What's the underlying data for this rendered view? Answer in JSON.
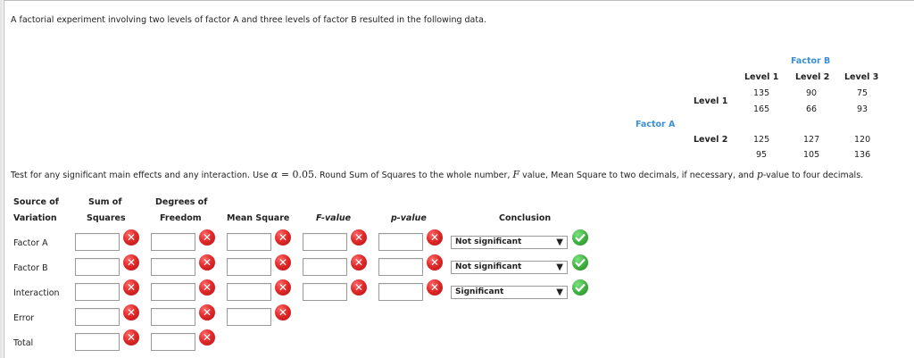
{
  "intro_text": "A factorial experiment involving two levels of factor A and three levels of factor B resulted in the following data.",
  "data_table": {
    "factor_b_label": "Factor B",
    "factor_a_label": "Factor A",
    "col_headers": [
      "Level 1",
      "Level 2",
      "Level 3"
    ],
    "row_headers": [
      "Level 1",
      "Level 2"
    ],
    "rows": [
      [
        [
          "135",
          "90",
          "75"
        ],
        [
          "165",
          "66",
          "93"
        ]
      ],
      [
        [
          "125",
          "127",
          "120"
        ],
        [
          "95",
          "105",
          "136"
        ]
      ]
    ]
  },
  "instructions": {
    "part1": "Test for any significant main effects and any interaction. Use ",
    "alpha": "α",
    "equals": " = 0.05",
    "part2": ". Round Sum of Squares to the whole number, ",
    "f": "F",
    "part3": " value, Mean Square to two decimals, if necessary, and ",
    "p": "p",
    "part4": "-value to four decimals."
  },
  "anova": {
    "headers": {
      "source_1": "Source of",
      "source_2": "Variation",
      "ss_1": "Sum of",
      "ss_2": "Squares",
      "df_1": "Degrees of",
      "df_2": "Freedom",
      "ms": "Mean Square",
      "f": "F-value",
      "p": "p-value",
      "conclusion": "Conclusion"
    },
    "rows": [
      {
        "label": "Factor A",
        "conclusion": "Not significant"
      },
      {
        "label": "Factor B",
        "conclusion": "Not significant"
      },
      {
        "label": "Interaction",
        "conclusion": "Significant"
      },
      {
        "label": "Error"
      },
      {
        "label": "Total"
      }
    ]
  },
  "icons": {
    "wrong": "x-circle-icon",
    "correct": "check-circle-icon",
    "dropdown": "chevron-down-icon"
  },
  "colors": {
    "factor_label": "#3a8fd6",
    "wrong": "#e22a2a",
    "correct": "#3fae3f"
  }
}
